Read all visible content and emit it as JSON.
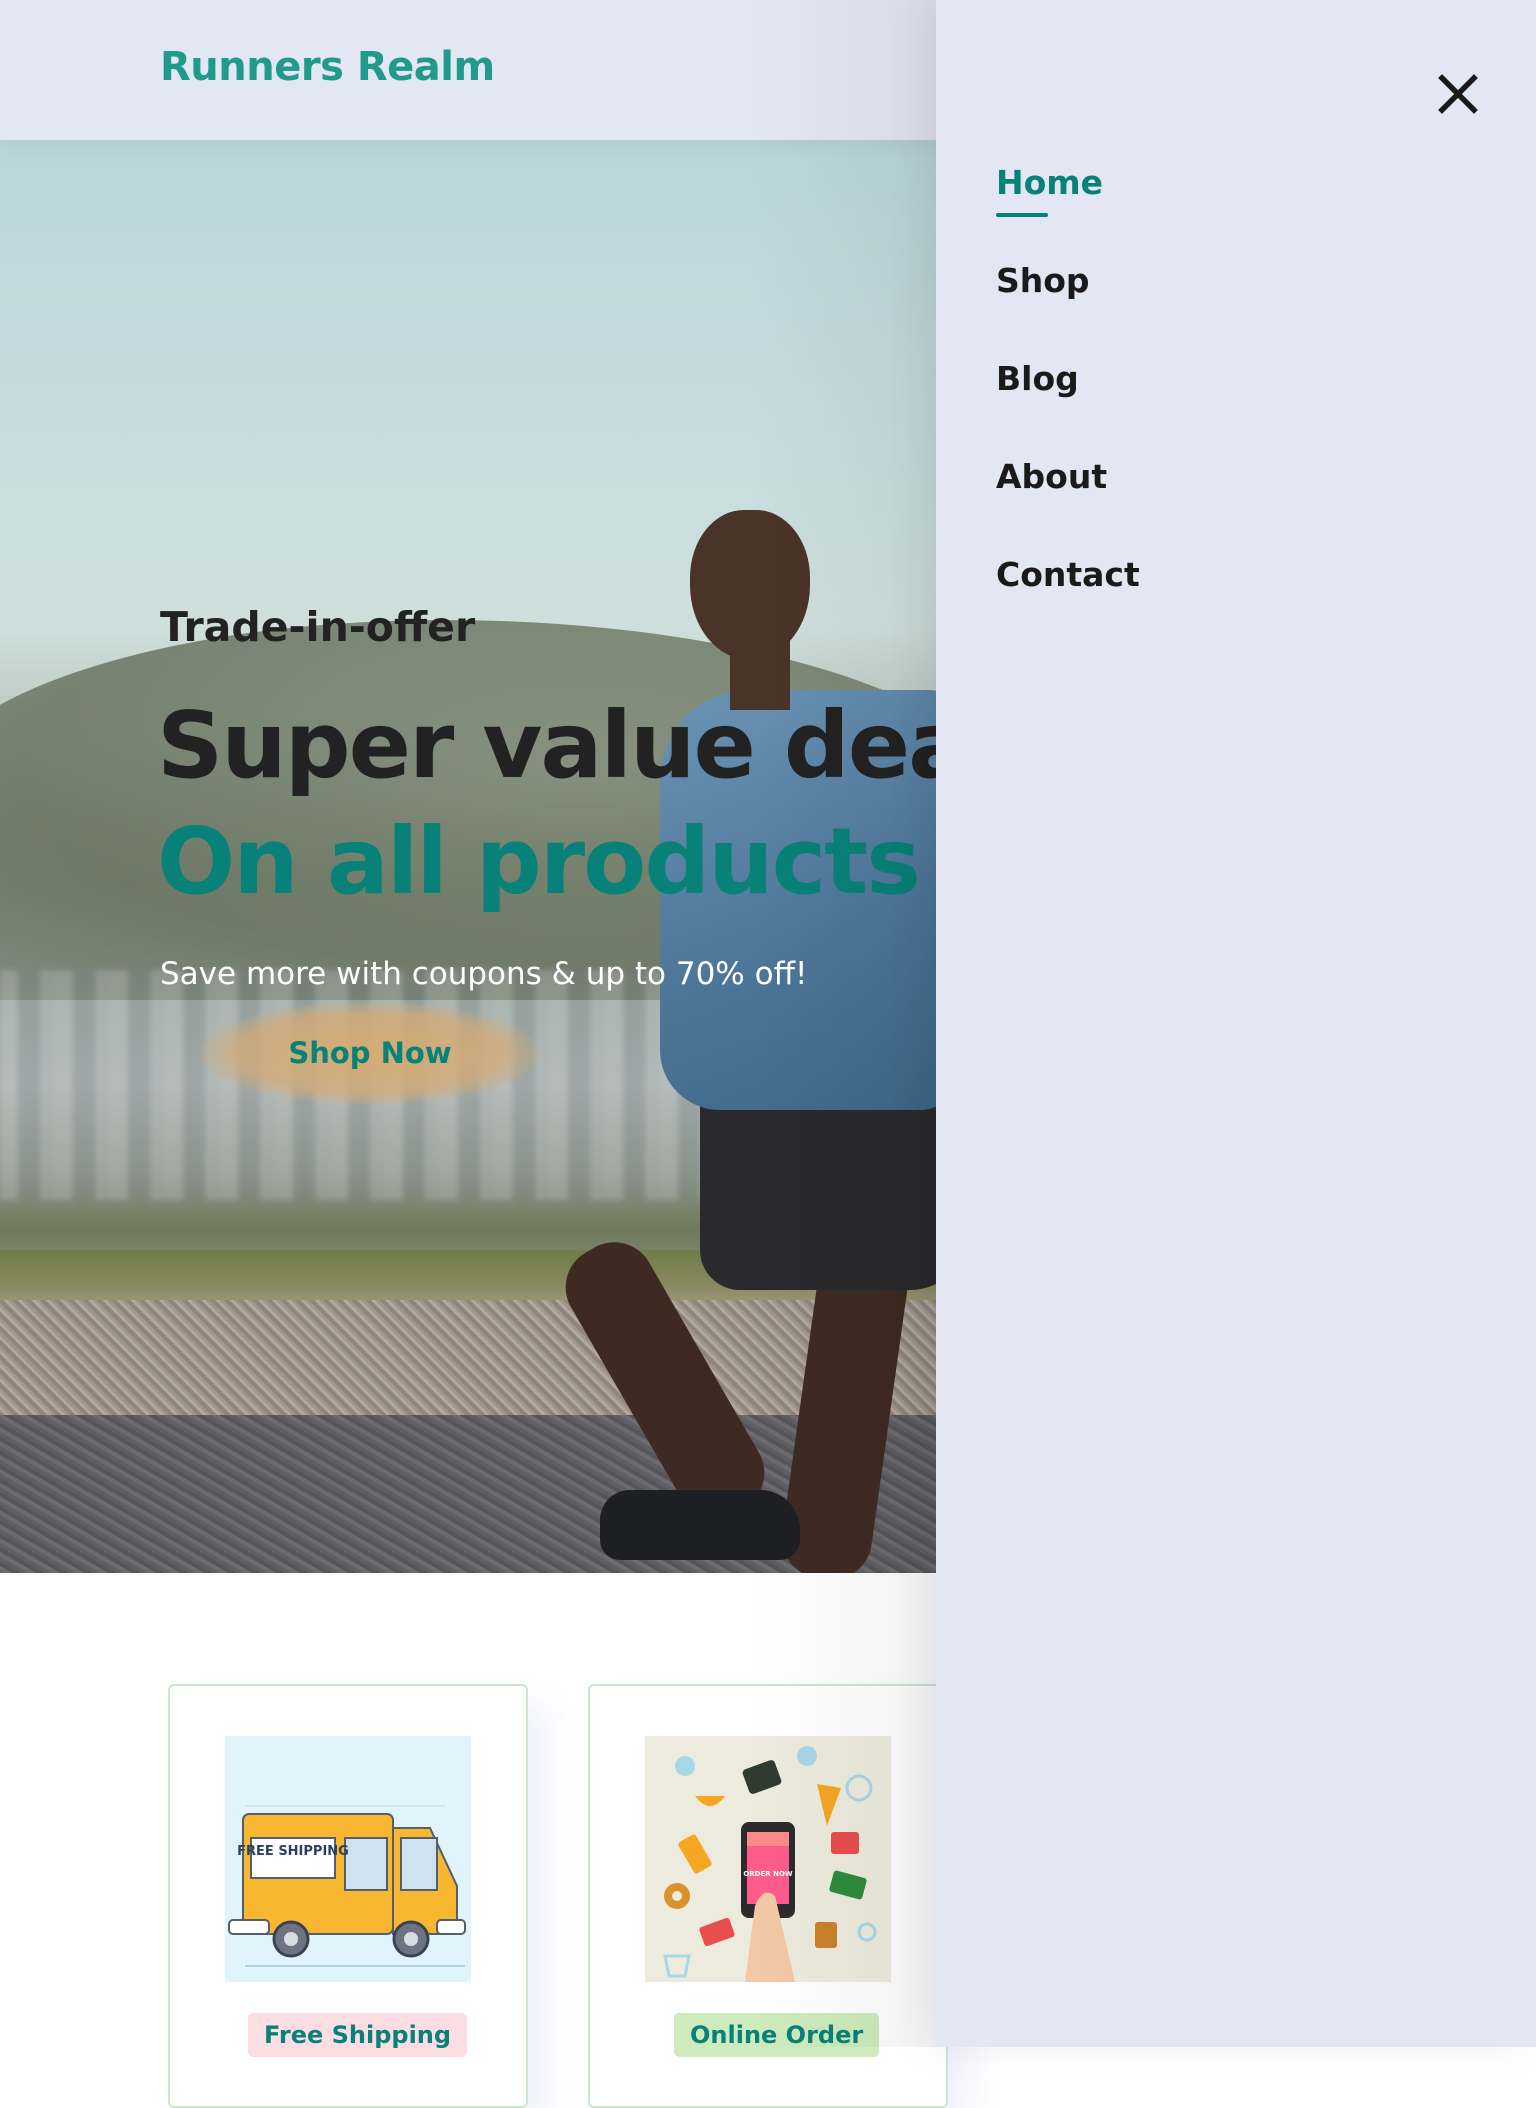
{
  "header": {
    "logo": "Runners Realm"
  },
  "hero": {
    "eyebrow": "Trade-in-offer",
    "headline": "Super value deals",
    "headline_accent": "On all products",
    "subtext": "Save more with coupons & up to 70% off!",
    "cta_label": "Shop Now",
    "accent_color": "#088178"
  },
  "features": [
    {
      "label": "Free Shipping",
      "image_text": "FREE SHIPPING",
      "badge_color": "#fddde4"
    },
    {
      "label": "Online Order",
      "image_text": "ORDER NOW",
      "badge_color": "#cdebbc"
    }
  ],
  "nav": {
    "items": [
      {
        "label": "Home",
        "active": true
      },
      {
        "label": "Shop",
        "active": false
      },
      {
        "label": "Blog",
        "active": false
      },
      {
        "label": "About",
        "active": false
      },
      {
        "label": "Contact",
        "active": false
      }
    ],
    "close_icon": "close-icon"
  }
}
